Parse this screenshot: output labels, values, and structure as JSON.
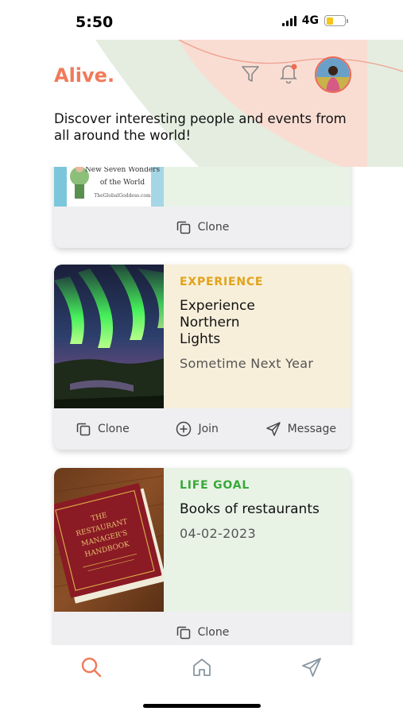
{
  "status_bar": {
    "time": "5:50",
    "network": "4G",
    "battery_percent": 40
  },
  "header": {
    "logo": "Alive.",
    "tagline": "Discover interesting people and events from all around the world!",
    "accent_color": "#f07a5a"
  },
  "cards": [
    {
      "image_caption_lines": [
        "New Seven Wonders",
        "of the World",
        "TheGlobalGoddess.com"
      ],
      "actions": [
        "Clone"
      ]
    },
    {
      "category": "EXPERIENCE",
      "category_color": "#e2a21a",
      "title": "Experience Northern Lights",
      "date": "Sometime Next Year",
      "background": "#f7efda",
      "actions": [
        "Clone",
        "Join",
        "Message"
      ]
    },
    {
      "category": "LIFE GOAL",
      "category_color": "#3aa83a",
      "title": "Books of restaurants",
      "date": "04-02-2023",
      "background": "#e8f3e6",
      "book_title_lines": [
        "THE",
        "RESTAURANT",
        "MANAGER'S",
        "HANDBOOK"
      ],
      "actions": [
        "Clone"
      ]
    }
  ],
  "bottom_nav": {
    "items": [
      "search-icon",
      "home-icon",
      "send-icon"
    ],
    "active": "search-icon"
  }
}
